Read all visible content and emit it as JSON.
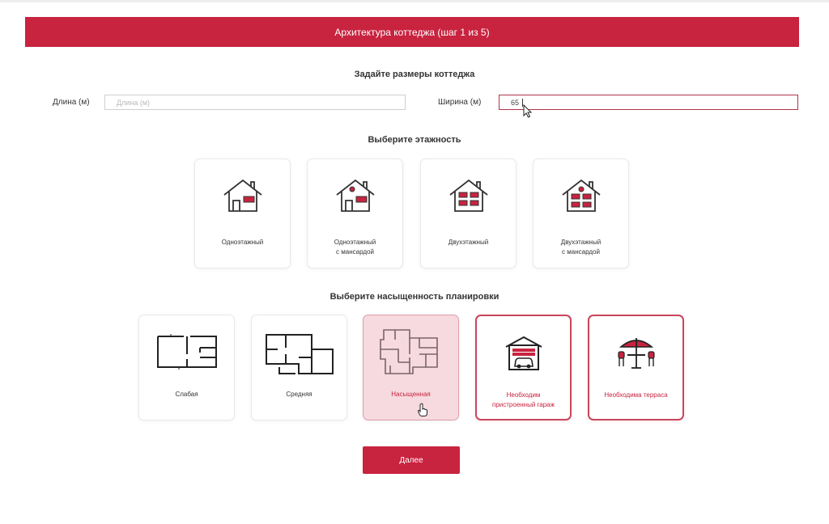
{
  "banner": {
    "title": "Архитектура коттеджа (шаг 1 из 5)"
  },
  "dimensions": {
    "title": "Задайте размеры коттеджа",
    "length": {
      "label": "Длина (м)",
      "placeholder": "Длина (м)",
      "value": ""
    },
    "width": {
      "label": "Ширина (м)",
      "placeholder": "Ширина (м)",
      "value": "65"
    }
  },
  "floors": {
    "title": "Выберите этажность",
    "options": [
      {
        "label": "Одноэтажный",
        "icon": "house-one-floor-icon"
      },
      {
        "label": "Одноэтажный с мансардой",
        "icon": "house-attic-icon"
      },
      {
        "label": "Двухэтажный",
        "icon": "house-two-floor-icon"
      },
      {
        "label": "Двухэтажный с мансардой",
        "icon": "house-two-floor-attic-icon"
      }
    ]
  },
  "density": {
    "title": "Выберите насыщенность планировки",
    "options": [
      {
        "label": "Слабая",
        "icon": "floorplan-simple-icon",
        "state": "normal"
      },
      {
        "label": "Средняя",
        "icon": "floorplan-medium-icon",
        "state": "normal"
      },
      {
        "label": "Насыщенная",
        "icon": "floorplan-dense-icon",
        "state": "hover"
      },
      {
        "label": "Необходим пристроенный гараж",
        "icon": "garage-icon",
        "state": "selected"
      },
      {
        "label": "Необходима терраса",
        "icon": "terrace-icon",
        "state": "selected"
      }
    ]
  },
  "next_button": {
    "label": "Далее"
  },
  "colors": {
    "accent": "#c8233f",
    "selected_border": "#c8475d",
    "hover_background": "#f6dadf"
  }
}
